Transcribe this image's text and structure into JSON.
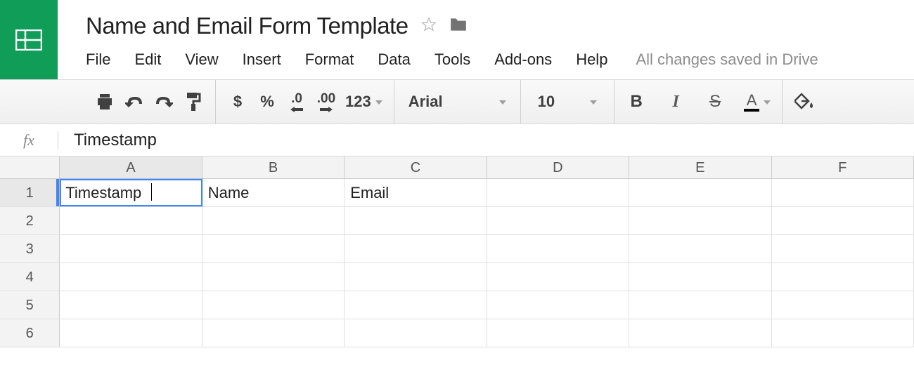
{
  "header": {
    "title": "Name and Email Form Template"
  },
  "menu": {
    "items": [
      "File",
      "Edit",
      "View",
      "Insert",
      "Format",
      "Data",
      "Tools",
      "Add-ons",
      "Help"
    ],
    "save_status": "All changes saved in Drive"
  },
  "toolbar": {
    "currency": "$",
    "percent": "%",
    "dec_decrease": ".0",
    "dec_increase": ".00",
    "numformat": "123",
    "font_name": "Arial",
    "font_size": "10",
    "bold": "B",
    "italic": "I",
    "strike": "S",
    "textcolor": "A"
  },
  "formula_bar": {
    "label": "fx",
    "value": "Timestamp"
  },
  "sheet": {
    "columns": [
      "A",
      "B",
      "C",
      "D",
      "E",
      "F"
    ],
    "rows": [
      "1",
      "2",
      "3",
      "4",
      "5",
      "6"
    ],
    "active_column": "A",
    "active_row": "1",
    "cells": {
      "A1": "Timestamp",
      "B1": "Name",
      "C1": "Email"
    }
  }
}
